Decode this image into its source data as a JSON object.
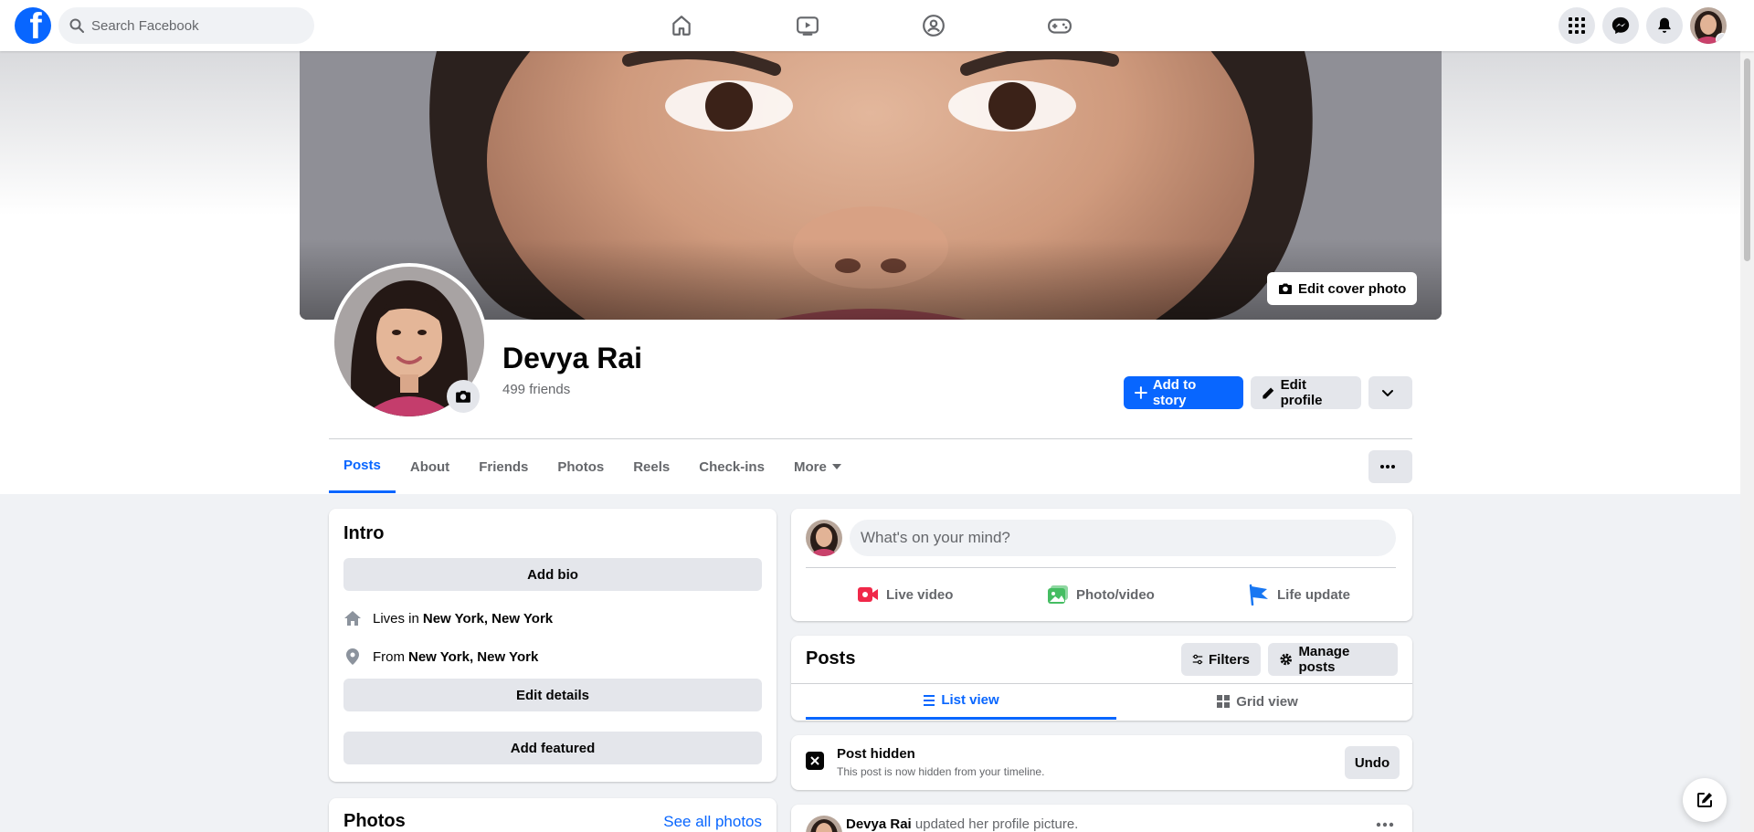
{
  "topbar": {
    "search_placeholder": "Search Facebook",
    "nav": [
      "home-icon",
      "video-icon",
      "groups-icon",
      "gaming-icon"
    ],
    "right": [
      "menu-grid-icon",
      "messenger-icon",
      "notifications-icon"
    ]
  },
  "cover": {
    "edit_label": "Edit cover photo"
  },
  "profile": {
    "name": "Devya Rai",
    "friends": "499 friends",
    "add_story_label": "Add to story",
    "edit_profile_label": "Edit profile"
  },
  "tabs": [
    {
      "label": "Posts",
      "active": true
    },
    {
      "label": "About"
    },
    {
      "label": "Friends"
    },
    {
      "label": "Photos"
    },
    {
      "label": "Reels"
    },
    {
      "label": "Check-ins"
    },
    {
      "label": "More"
    }
  ],
  "intro": {
    "title": "Intro",
    "add_bio": "Add bio",
    "lives_prefix": "Lives in",
    "lives_place": "New York, New York",
    "from_prefix": "From",
    "from_place": "New York, New York",
    "edit_details": "Edit details",
    "add_featured": "Add featured"
  },
  "photos": {
    "title": "Photos",
    "see_all": "See all photos"
  },
  "composer": {
    "placeholder": "What's on your mind?",
    "live_video": "Live video",
    "photo_video": "Photo/video",
    "life_update": "Life update"
  },
  "posts_header": {
    "title": "Posts",
    "filters": "Filters",
    "manage_posts": "Manage posts",
    "list_view": "List view",
    "grid_view": "Grid view"
  },
  "hidden_post": {
    "title": "Post hidden",
    "subtitle": "This post is now hidden from your timeline.",
    "undo": "Undo"
  },
  "post_preview": {
    "author": "Devya Rai",
    "action": "updated her profile picture."
  },
  "colors": {
    "brand": "#0866ff",
    "text_secondary": "#65676b",
    "button_gray": "#e4e6eb"
  }
}
